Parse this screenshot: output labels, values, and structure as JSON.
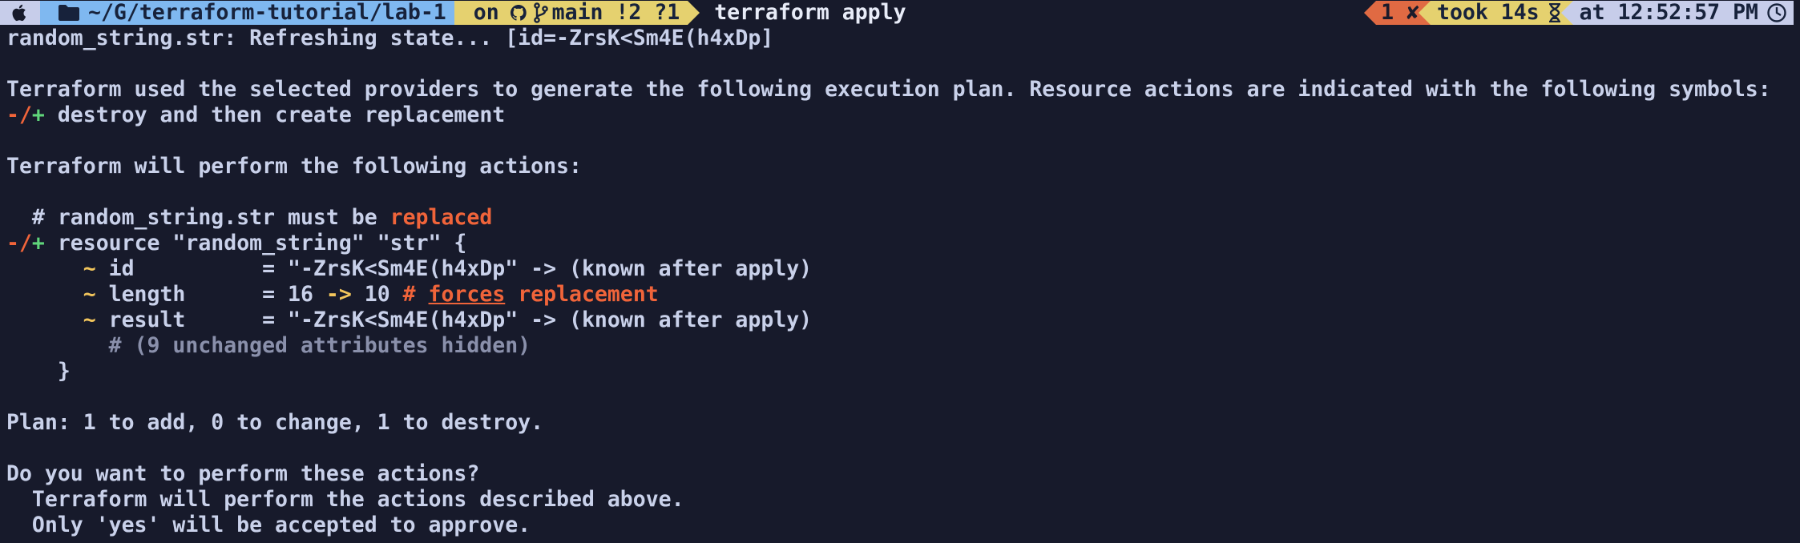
{
  "prompt": {
    "os_icon": "apple-icon",
    "folder_icon": "folder-icon",
    "path": "~/G/terraform-tutorial/lab-1",
    "on_label": "on",
    "github_icon": "github-icon",
    "branch_icon": "git-branch-icon",
    "branch": "main !2 ?1",
    "command": "terraform apply",
    "status": "1 ✘",
    "took_label": "took 14s",
    "hourglass_icon": "hourglass-icon",
    "time_label": "at 12:52:57 PM",
    "clock_icon": "clock-icon"
  },
  "output": {
    "refresh": "random_string.str: Refreshing state... [id=-ZrsK<Sm4E(h4xDp]",
    "plan_intro": "Terraform used the selected providers to generate the following execution plan. Resource actions are indicated with the following symbols:",
    "symbol": "-/+",
    "symbol_desc": " destroy and then create replacement",
    "actions_header": "Terraform will perform the following actions:",
    "comment_prefix": "  # random_string.str must be ",
    "comment_replaced": "replaced",
    "resource_symbol": "-/+",
    "resource_decl": " resource \"random_string\" \"str\" {",
    "attr_id_tilde": "      ~",
    "attr_id": " id          = \"-ZrsK<Sm4E(h4xDp\" -> (known after apply)",
    "attr_len_tilde": "      ~",
    "attr_len": " length      = 16 ",
    "attr_len_arrow": "->",
    "attr_len_val": " 10 ",
    "attr_len_hash": "# ",
    "attr_len_forces": "forces",
    "attr_len_replacement": " replacement",
    "attr_result_tilde": "      ~",
    "attr_result": " result      = \"-ZrsK<Sm4E(h4xDp\" -> (known after apply)",
    "unchanged": "        # (9 unchanged attributes hidden)",
    "close_brace": "    }",
    "plan_summary": "Plan: 1 to add, 0 to change, 1 to destroy.",
    "confirm_q": "Do you want to perform these actions?",
    "confirm_1": "  Terraform will perform the actions described above.",
    "confirm_2": "  Only 'yes' will be accepted to approve."
  },
  "colors": {
    "background": "#171a2b",
    "text": "#c9d1ea",
    "red": "#f0643a",
    "green": "#5fd47a",
    "yellow": "#f2c55c",
    "dir_segment": "#7fb8f0",
    "git_segment": "#e5d16f",
    "os_segment": "#c7cdea",
    "error_segment": "#e06a43"
  }
}
